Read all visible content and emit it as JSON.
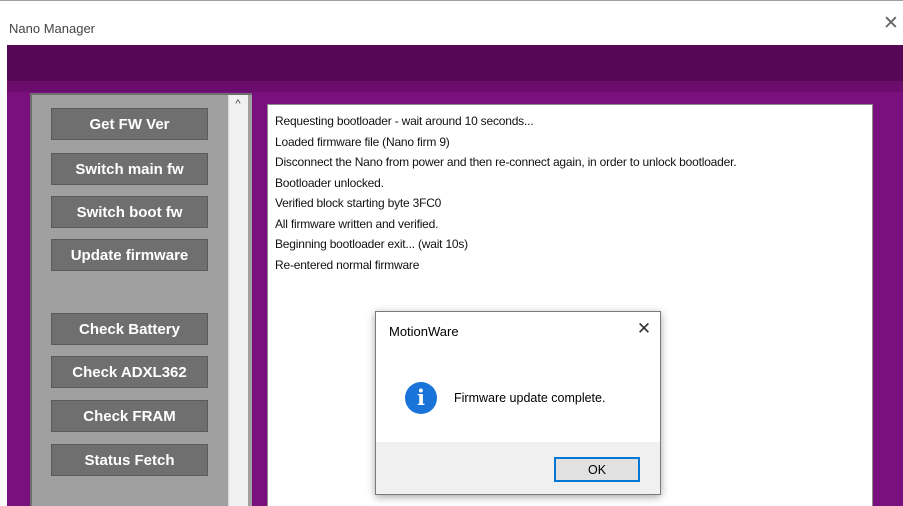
{
  "window": {
    "title": "Nano Manager",
    "close_glyph": "✕",
    "close_icon": "close-icon"
  },
  "colors": {
    "purple": "#7a0f7e",
    "purple_dark": "#560857",
    "panel_gray": "#a0a0a0",
    "button_gray": "#6f6f6f",
    "info_blue": "#1a73d9",
    "focus_blue": "#0078d7"
  },
  "buttons": [
    {
      "label": "Get FW Ver"
    },
    {
      "label": "Switch main fw"
    },
    {
      "label": "Switch boot fw"
    },
    {
      "label": "Update firmware"
    },
    {
      "label": "Check Battery"
    },
    {
      "label": "Check ADXL362"
    },
    {
      "label": "Check FRAM"
    },
    {
      "label": "Status Fetch"
    }
  ],
  "scrollbar": {
    "up_glyph": "^",
    "up_icon": "chevron-up-icon"
  },
  "log": {
    "lines": [
      "Requesting bootloader - wait around 10 seconds...",
      "Loaded firmware file (Nano firm 9)",
      "Disconnect the Nano from power and then re-connect again, in order to unlock bootloader.",
      "Bootloader unlocked.",
      "Verified block starting byte 3FC0",
      "All firmware written and verified.",
      "Beginning bootloader exit... (wait 10s)",
      "Re-entered normal firmware"
    ]
  },
  "dialog": {
    "title": "MotionWare",
    "close_glyph": "✕",
    "icon": "info-icon",
    "icon_glyph": "i",
    "message": "Firmware update complete.",
    "ok_label": "OK"
  }
}
